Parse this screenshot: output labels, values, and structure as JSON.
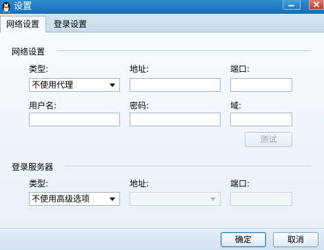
{
  "window": {
    "title": "设置"
  },
  "tabs": [
    {
      "label": "网络设置",
      "active": true
    },
    {
      "label": "登录设置",
      "active": false
    }
  ],
  "network": {
    "section_title": "网络设置",
    "type_label": "类型:",
    "type_value": "不使用代理",
    "address_label": "地址:",
    "address_value": "",
    "port_label": "端口:",
    "port_value": "",
    "username_label": "用户名:",
    "username_value": "",
    "password_label": "密码:",
    "password_value": "",
    "domain_label": "域:",
    "domain_value": "",
    "test_button": "测试"
  },
  "login_server": {
    "section_title": "登录服务器",
    "type_label": "类型:",
    "type_value": "不使用高级选项",
    "address_label": "地址:",
    "address_value": "",
    "port_label": "端口:",
    "port_value": ""
  },
  "footer": {
    "ok_label": "确定",
    "cancel_label": "取消"
  },
  "colors": {
    "titlebar": "#1a6db7",
    "panel_bg": "#f7fbfe",
    "accent": "#3d7fb8"
  }
}
